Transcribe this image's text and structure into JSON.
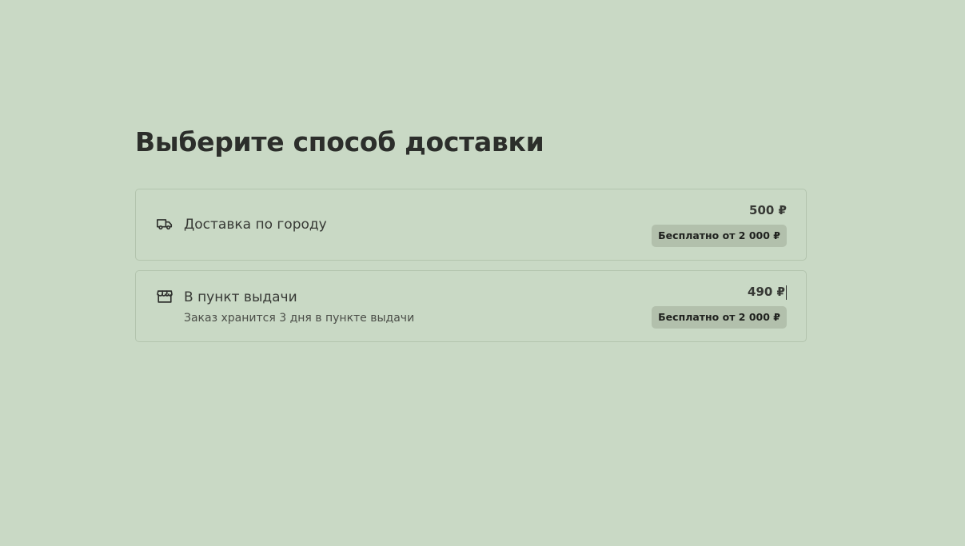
{
  "page": {
    "title": "Выберите способ доставки"
  },
  "options": [
    {
      "icon": "truck-icon",
      "title": "Доставка по городу",
      "subtitle": "",
      "price": "500 ₽",
      "badge": "Бесплатно от 2 000 ₽"
    },
    {
      "icon": "store-icon",
      "title": "В пункт выдачи",
      "subtitle": "Заказ хранится 3 дня в пункте выдачи",
      "price": "490 ₽",
      "badge": "Бесплатно от 2 000 ₽"
    }
  ],
  "colors": {
    "background": "#c9d9c5",
    "text": "#2f312e",
    "badge_bg": "#b2c0ac",
    "border": "#b3c4ae"
  }
}
